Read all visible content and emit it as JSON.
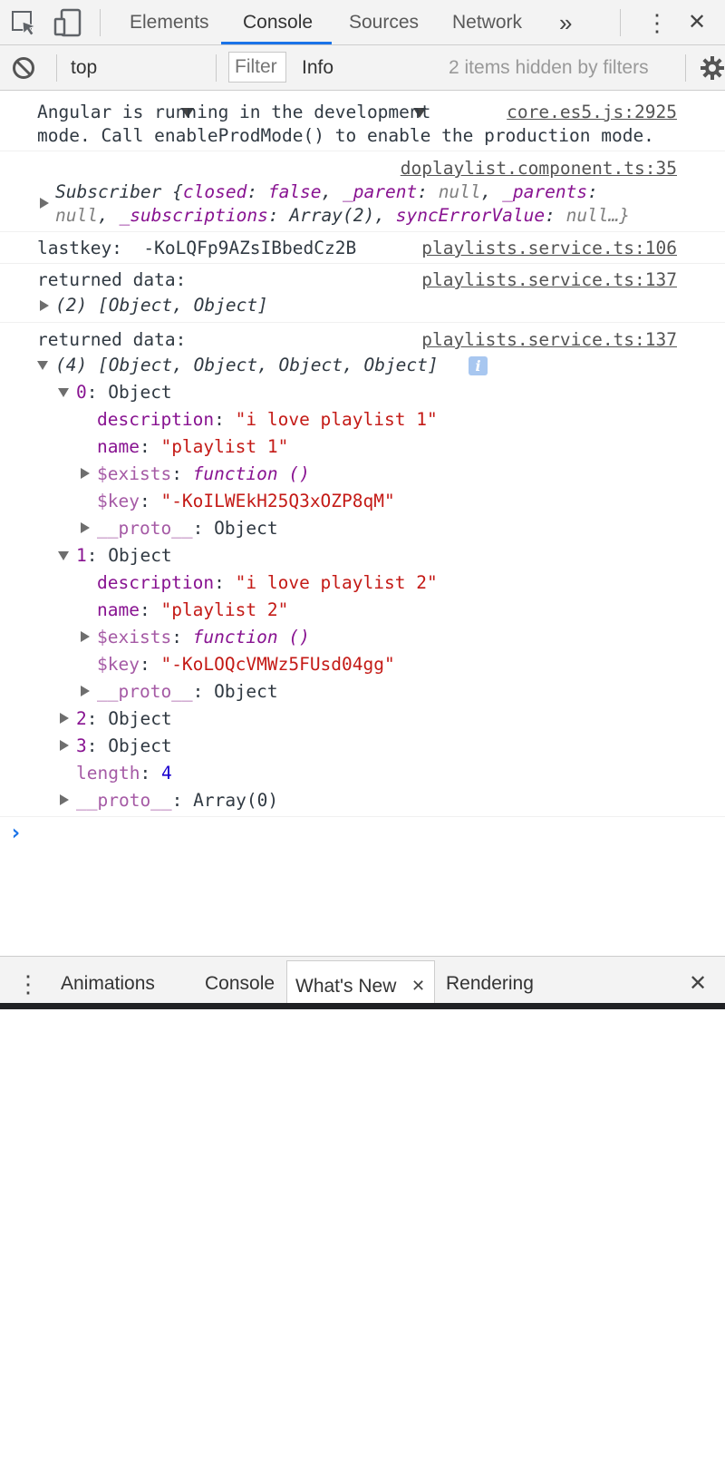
{
  "toolbar": {
    "tabs": [
      "Elements",
      "Console",
      "Sources",
      "Network"
    ],
    "active_tab": "Console",
    "more_tabs": "»",
    "close": "✕",
    "menu": "⋮",
    "accent": "#1a73e8"
  },
  "filterbar": {
    "context": "top",
    "filter_placeholder": "Filter",
    "level": "Info",
    "hidden_note": "2 items hidden by filters"
  },
  "console": {
    "messages": [
      {
        "text_line1": "Angular is running in the development",
        "text_line2": "mode. Call enableProdMode() to enable the production mode.",
        "source": "core.es5.js:2925"
      },
      {
        "source": "doplaylist.component.ts:35",
        "object": {
          "prefix": "Subscriber {",
          "closed_key": "closed",
          "closed_val": "false",
          "parent_key": "_parent",
          "parent_val": "null",
          "parents_key": "_parents",
          "parents_val": "null",
          "subs_key": "_subscriptions",
          "subs_val": "Array(2)",
          "err_key": "syncErrorValue",
          "err_val": "null…}"
        }
      },
      {
        "label": "lastkey:",
        "value": "-KoLQFp9AZsIBbedCz2B",
        "source": "playlists.service.ts:106"
      },
      {
        "label": "returned data:",
        "source": "playlists.service.ts:137",
        "summary": "(2) [Object, Object]"
      },
      {
        "label": "returned data:",
        "source": "playlists.service.ts:137",
        "summary": "(4) [Object, Object, Object, Object]",
        "info_badge": "i",
        "items": [
          {
            "index": "0",
            "type": "Object",
            "description": "\"i love playlist 1\"",
            "name": "\"playlist 1\"",
            "exists": "function ()",
            "key": "\"-KoILWEkH25Q3xOZP8qM\"",
            "proto": "Object"
          },
          {
            "index": "1",
            "type": "Object",
            "description": "\"i love playlist 2\"",
            "name": "\"playlist 2\"",
            "exists": "function ()",
            "key": "\"-KoLOQcVMWz5FUsd04gg\"",
            "proto": "Object"
          },
          {
            "index": "2",
            "type": "Object"
          },
          {
            "index": "3",
            "type": "Object"
          }
        ],
        "length": "4",
        "proto": "Array(0)"
      }
    ],
    "prompt": "›",
    "labels": {
      "description": "description",
      "name": "name",
      "exists": "$exists",
      "key": "$key",
      "proto": "__proto__",
      "length": "length"
    }
  },
  "drawer": {
    "tabs": [
      "Animations",
      "Console",
      "What's New",
      "Rendering"
    ],
    "active_tab": "What's New",
    "tab_close": "✕",
    "close": "✕",
    "menu": "⋮"
  }
}
